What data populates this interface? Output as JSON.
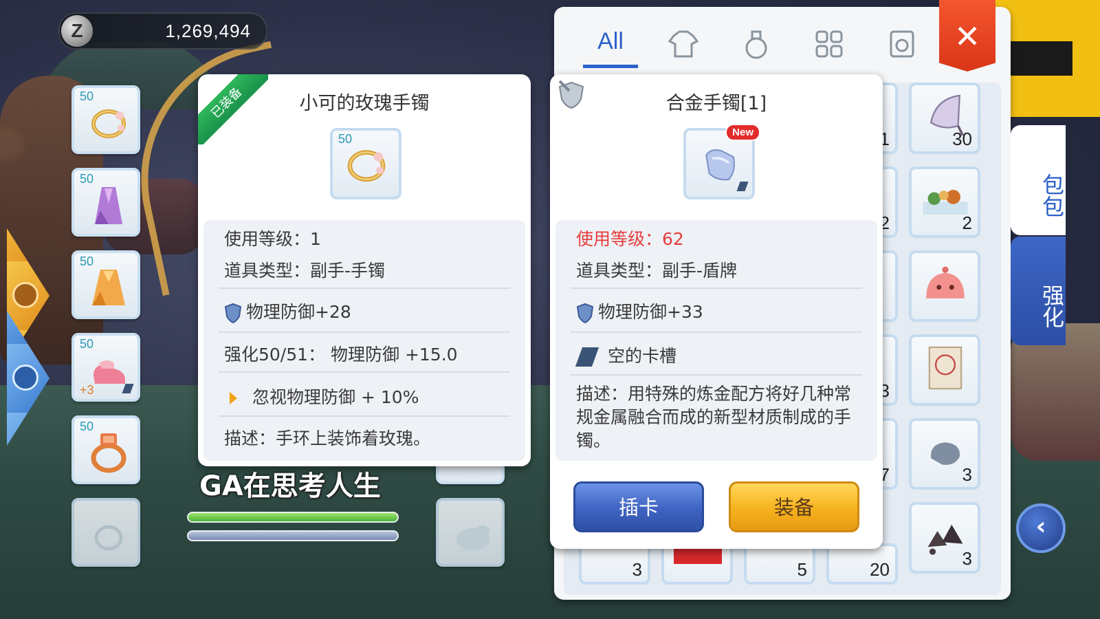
{
  "currency": {
    "amount": "1,269,494",
    "icon": "zeny-coin-icon"
  },
  "player": {
    "name": "GA在思考人生",
    "hp_fraction": 1.0,
    "sp_fraction": 1.0
  },
  "equipment_slots": [
    {
      "level": "50",
      "icon": "rose-bracelet-icon"
    },
    {
      "level": "50",
      "icon": "purple-robe-icon"
    },
    {
      "level": "50",
      "icon": "orange-cape-icon"
    },
    {
      "level": "50",
      "refine": "+3",
      "icon": "pink-shoes-icon",
      "has_card_slot": true
    },
    {
      "level": "50",
      "icon": "ring-icon"
    },
    {
      "level": "",
      "icon": "empty-accessory-icon"
    }
  ],
  "left_tooltip": {
    "equipped_ribbon": "已装备",
    "title": "小可的玫瑰手镯",
    "level": "50",
    "use_level": "使用等级：1",
    "item_type": "道具类型：副手-手镯",
    "phys_def": "物理防御+28",
    "refine": "强化50/51：   物理防御 +15.0",
    "ignore_def": "忽视物理防御 + 10%",
    "description": "描述：手环上装饰着玫瑰。"
  },
  "right_tooltip": {
    "title": "合金手镯[1]",
    "new_badge": "New",
    "use_level": "使用等级：62",
    "item_type": "道具类型：副手-盾牌",
    "phys_def": "物理防御+33",
    "card_slot": "空的卡槽",
    "description": "描述：用特殊的炼金配方将好几种常规金属融合而成的新型材质制成的手镯。",
    "btn_card": "插卡",
    "btn_equip": "装备"
  },
  "inventory": {
    "tabs": [
      {
        "label": "All",
        "icon": "all-tab"
      },
      {
        "label": "",
        "icon": "armor-icon"
      },
      {
        "label": "",
        "icon": "potion-icon"
      },
      {
        "label": "",
        "icon": "grid-icon"
      },
      {
        "label": "",
        "icon": "card-icon"
      }
    ],
    "close_icon": "close-icon",
    "side_tabs": [
      "包包",
      "强化"
    ],
    "partial_qty": [
      "1",
      "2",
      "",
      "3",
      "7",
      ""
    ],
    "items": [
      {
        "icon": "butterfly-wing-icon",
        "qty": "30"
      },
      {
        "icon": "food-tray-icon",
        "qty": "2"
      },
      {
        "icon": "poring-icon",
        "qty": ""
      },
      {
        "icon": "scroll-icon",
        "qty": ""
      },
      {
        "icon": "stone-icon",
        "qty": "3"
      },
      {
        "icon": "ore-icon",
        "qty": "3"
      }
    ],
    "bottom_row": [
      {
        "icon": "item-icon",
        "qty": "3"
      },
      {
        "icon": "red-box-icon",
        "qty": ""
      },
      {
        "icon": "pen-icon",
        "qty": "5"
      },
      {
        "icon": "gold-icon",
        "qty": "20"
      }
    ]
  },
  "colors": {
    "accent_blue": "#2b60c8",
    "red_text": "#e63e3e",
    "equipped_green": "#2fb85c",
    "button_yellow": "#f6b21e"
  }
}
